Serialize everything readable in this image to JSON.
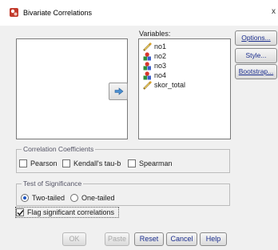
{
  "window": {
    "title": "Bivariate Correlations",
    "close_glyph": "x"
  },
  "variables": {
    "label": "Variables:",
    "items": [
      {
        "name": "no1",
        "icon": "scale-icon"
      },
      {
        "name": "no2",
        "icon": "ordinal-icon"
      },
      {
        "name": "no3",
        "icon": "ordinal-icon"
      },
      {
        "name": "no4",
        "icon": "ordinal-icon"
      },
      {
        "name": "skor_total",
        "icon": "scale-icon"
      }
    ]
  },
  "side_buttons": {
    "options": "Options...",
    "style": "Style...",
    "bootstrap": "Bootstrap..."
  },
  "coefficients": {
    "legend": "Correlation Coefficients",
    "pearson": {
      "label": "Pearson",
      "checked": false
    },
    "kendall": {
      "label": "Kendall's tau-b",
      "checked": false
    },
    "spearman": {
      "label": "Spearman",
      "checked": false
    }
  },
  "significance": {
    "legend": "Test of Significance",
    "two_tailed": {
      "label": "Two-tailed",
      "selected": true
    },
    "one_tailed": {
      "label": "One-tailed",
      "selected": false
    }
  },
  "flag": {
    "label": "Flag significant correlations",
    "checked": true
  },
  "buttons": {
    "ok": "OK",
    "paste": "Paste",
    "reset": "Reset",
    "cancel": "Cancel",
    "help": "Help"
  },
  "colors": {
    "accent_text": "#1c2f8f",
    "background": "#f0f0f0",
    "radio_dot": "#1f57c3"
  }
}
